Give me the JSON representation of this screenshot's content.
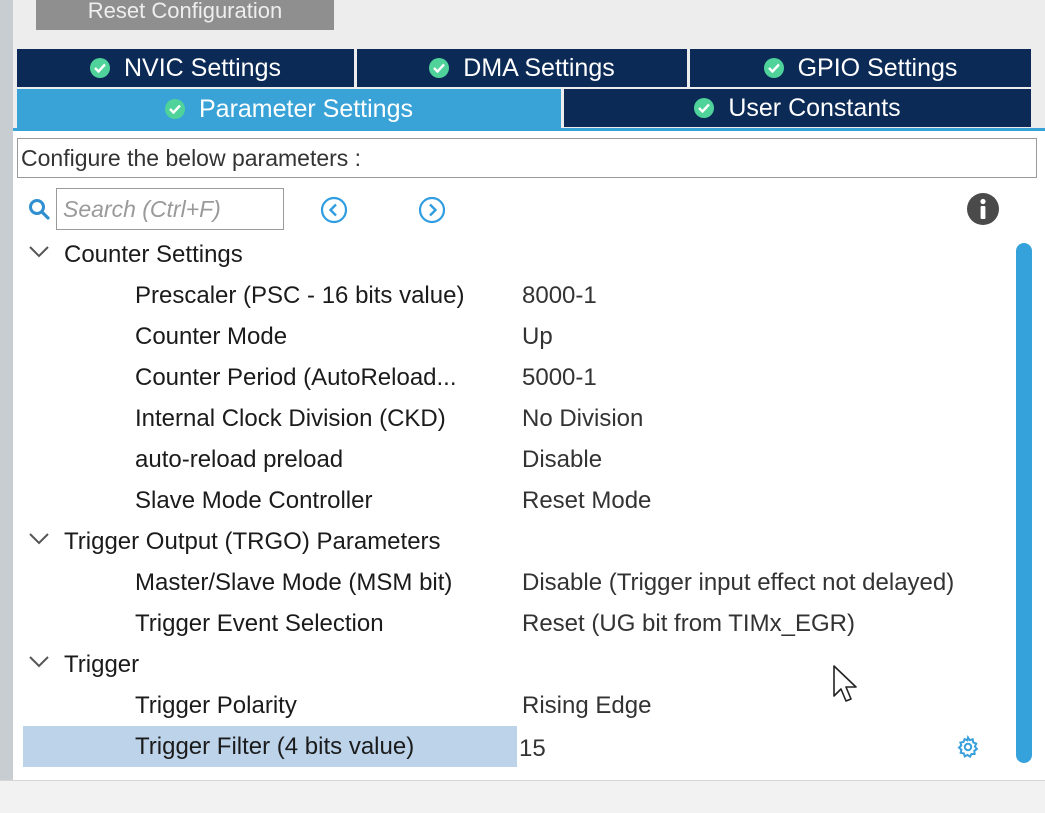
{
  "toolbar": {
    "reset_label": "Reset Configuration"
  },
  "tabs": [
    {
      "label": "NVIC Settings",
      "active": false
    },
    {
      "label": "DMA Settings",
      "active": false
    },
    {
      "label": "GPIO Settings",
      "active": false
    },
    {
      "label": "Parameter Settings",
      "active": true
    },
    {
      "label": "User Constants",
      "active": false
    }
  ],
  "description": "Configure the below parameters :",
  "search": {
    "placeholder": "Search (Ctrl+F)",
    "value": ""
  },
  "icons": {
    "search": "search-icon",
    "prev": "chevron-left-circle-icon",
    "next": "chevron-right-circle-icon",
    "info": "info-icon",
    "group_toggle": "chevron-down-icon",
    "settings": "gear-icon",
    "tab_status": "check-circle-icon"
  },
  "colors": {
    "tab_bg": "#0b2a56",
    "tab_active": "#39a3d7",
    "check_green": "#4fd39a",
    "selection": "#bdd3ea",
    "scrollbar": "#35a2db"
  },
  "groups": [
    {
      "title": "Counter Settings",
      "params": [
        {
          "name": "Prescaler (PSC - 16 bits value)",
          "value": "8000-1"
        },
        {
          "name": "Counter Mode",
          "value": "Up"
        },
        {
          "name": "Counter Period (AutoReload...",
          "value": "5000-1"
        },
        {
          "name": "Internal Clock Division (CKD)",
          "value": "No Division"
        },
        {
          "name": "auto-reload preload",
          "value": "Disable"
        },
        {
          "name": "Slave Mode Controller",
          "value": "Reset Mode"
        }
      ]
    },
    {
      "title": "Trigger Output (TRGO) Parameters",
      "params": [
        {
          "name": "Master/Slave Mode (MSM bit)",
          "value": "Disable (Trigger input effect not delayed)"
        },
        {
          "name": "Trigger Event Selection",
          "value": "Reset (UG bit from TIMx_EGR)"
        }
      ]
    },
    {
      "title": "Trigger",
      "params": [
        {
          "name": "Trigger Polarity",
          "value": "Rising Edge"
        },
        {
          "name": "Trigger Filter (4 bits value)",
          "value": "15",
          "selected": true
        }
      ]
    }
  ]
}
